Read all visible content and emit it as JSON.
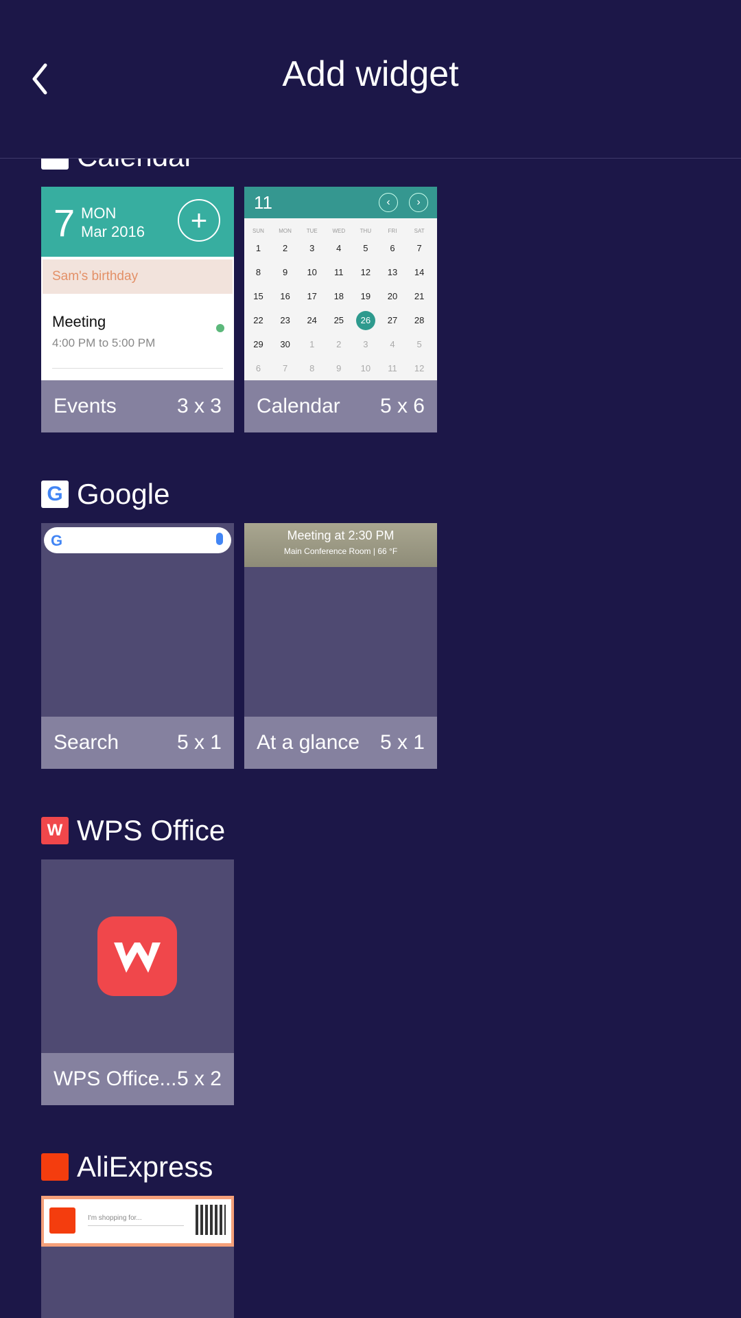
{
  "header": {
    "title": "Add widget"
  },
  "sections": {
    "calendar": {
      "title": "Calendar",
      "events_widget": {
        "day": "7",
        "dow": "MON",
        "date": "Mar 2016",
        "birthday": "Sam's birthday",
        "meeting": "Meeting",
        "time": "4:00 PM to 5:00 PM",
        "name": "Events",
        "size": "3 x 3"
      },
      "calendar_widget": {
        "month": "11",
        "weekdays": [
          "SUN",
          "MON",
          "TUE",
          "WED",
          "THU",
          "FRI",
          "SAT"
        ],
        "weeks": [
          [
            "1",
            "2",
            "3",
            "4",
            "5",
            "6",
            "7"
          ],
          [
            "8",
            "9",
            "10",
            "11",
            "12",
            "13",
            "14"
          ],
          [
            "15",
            "16",
            "17",
            "18",
            "19",
            "20",
            "21"
          ],
          [
            "22",
            "23",
            "24",
            "25",
            "26",
            "27",
            "28"
          ],
          [
            "29",
            "30",
            "1",
            "2",
            "3",
            "4",
            "5"
          ],
          [
            "6",
            "7",
            "8",
            "9",
            "10",
            "11",
            "12"
          ]
        ],
        "today": "26",
        "name": "Calendar",
        "size": "5 x 6"
      }
    },
    "google": {
      "title": "Google",
      "search_widget": {
        "name": "Search",
        "size": "5 x 1"
      },
      "glance_widget": {
        "headline": "Meeting at 2:30 PM",
        "detail": "Main Conference Room | 66 °F",
        "name": "At a glance",
        "size": "5 x 1"
      }
    },
    "wps": {
      "title": "WPS Office",
      "widget": {
        "name": "WPS Office...",
        "size": "5 x 2"
      }
    },
    "aliexpress": {
      "title": "AliExpress",
      "widget": {
        "placeholder": "I'm shopping for..."
      }
    }
  },
  "colors": {
    "background": "#1c1748",
    "card": "#4f4a72",
    "footer": "#85819f",
    "teal": "#37aea0"
  }
}
